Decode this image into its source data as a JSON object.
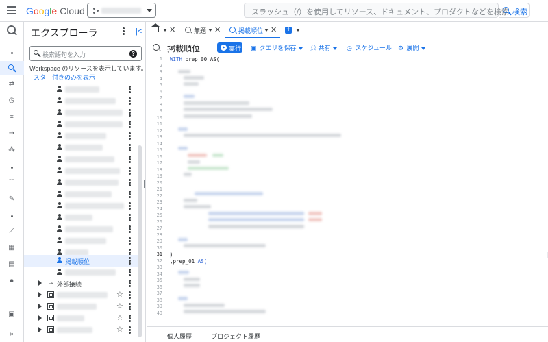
{
  "topbar": {
    "brand_letters": [
      "G",
      "o",
      "o",
      "g",
      "l",
      "e"
    ],
    "brand_suffix": "Cloud",
    "search_placeholder": "スラッシュ（/）を使用してリソース、ドキュメント、プロダクトなどを検索",
    "search_button": "検索"
  },
  "explorer": {
    "title": "エクスプローラ",
    "search_placeholder": "検索語句を入力",
    "help_icon": "?",
    "workspace_text": "Workspace のリソースを表示しています。",
    "starred_link": "スター付きのみを表示",
    "selected_query": "掲載順位",
    "external_connections": "外部接続"
  },
  "tabs": {
    "untitled": "無題",
    "active": "掲載順位",
    "plus": "+"
  },
  "toolbar": {
    "query_title": "掲載順位",
    "run": "実行",
    "save": "クエリを保存",
    "share": "共有",
    "schedule": "スケジュール",
    "expand": "展開"
  },
  "editor": {
    "line_count": 40,
    "current_line": 31,
    "line1_kw": "WITH",
    "line1_rest": " prep_00 AS(",
    "line31": ")",
    "line32_prefix": ",",
    "line32_name": "prep_01 ",
    "line32_kw": "AS("
  },
  "bottom": {
    "personal_history": "個人履歴",
    "project_history": "プロジェクト履歴"
  },
  "colors": {
    "accent": "#1a73e8",
    "border": "#dadce0",
    "text": "#3c4043"
  }
}
